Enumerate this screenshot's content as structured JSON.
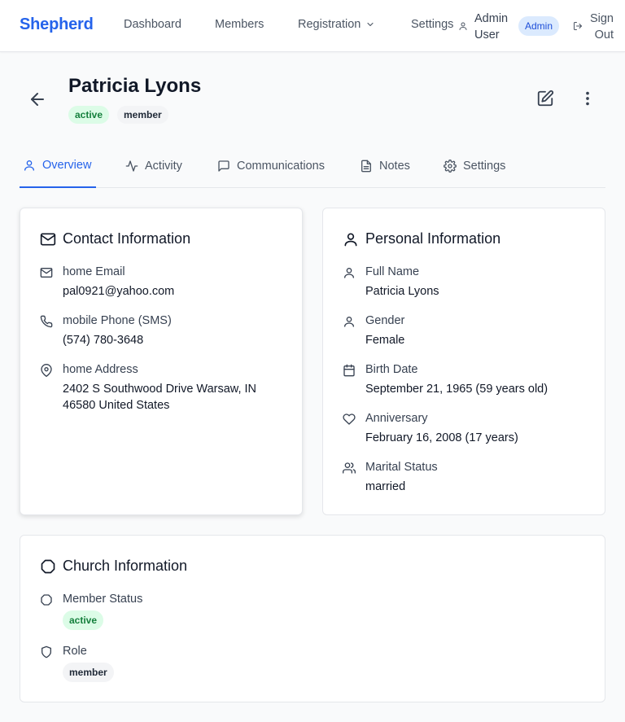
{
  "nav": {
    "brand": "Shepherd",
    "dashboard": "Dashboard",
    "members": "Members",
    "registration": "Registration",
    "settings": "Settings",
    "user_name": "Admin User",
    "role_badge": "Admin",
    "sign_out": "Sign Out"
  },
  "header": {
    "name": "Patricia Lyons",
    "badges": [
      "active",
      "member"
    ]
  },
  "tabs": [
    {
      "label": "Overview",
      "icon": "user-icon",
      "active": true
    },
    {
      "label": "Activity",
      "icon": "activity-icon",
      "active": false
    },
    {
      "label": "Communications",
      "icon": "message-icon",
      "active": false
    },
    {
      "label": "Notes",
      "icon": "file-text-icon",
      "active": false
    },
    {
      "label": "Settings",
      "icon": "gear-icon",
      "active": false
    }
  ],
  "contact": {
    "title": "Contact Information",
    "email_label": "home Email",
    "email_value": "pal0921@yahoo.com",
    "phone_label": "mobile Phone (SMS)",
    "phone_value": "(574) 780-3648",
    "address_label": "home Address",
    "address_line1": "2402 S Southwood Drive Warsaw, IN",
    "address_line2": "46580 United States"
  },
  "personal": {
    "title": "Personal Information",
    "full_name_label": "Full Name",
    "full_name_value": "Patricia Lyons",
    "gender_label": "Gender",
    "gender_value": "Female",
    "birth_label": "Birth Date",
    "birth_value": "September 21, 1965 (59 years old)",
    "anniversary_label": "Anniversary",
    "anniversary_value": "February 16, 2008 (17 years)",
    "marital_label": "Marital Status",
    "marital_value": "married"
  },
  "church": {
    "title": "Church Information",
    "status_label": "Member Status",
    "status_value": "active",
    "role_label": "Role",
    "role_value": "member"
  },
  "colors": {
    "accent": "#2563eb",
    "active_badge_bg": "#dcfce7",
    "active_badge_fg": "#15803d",
    "admin_badge_bg": "#dbeafe"
  }
}
